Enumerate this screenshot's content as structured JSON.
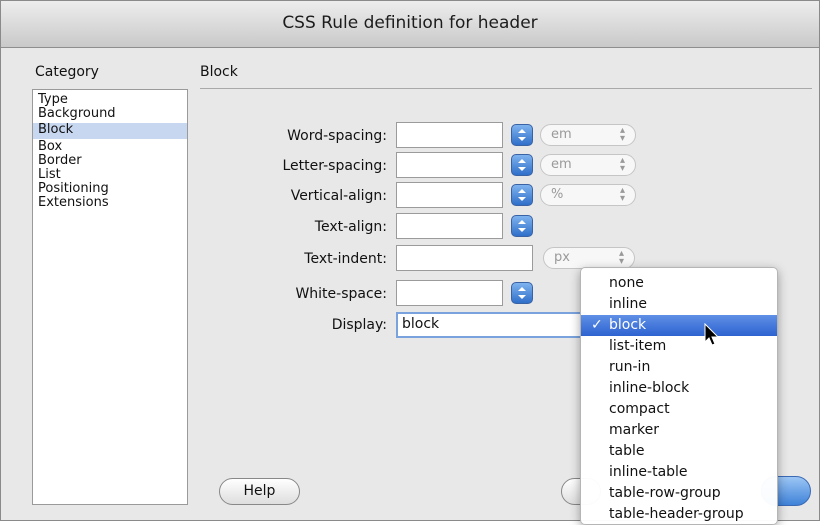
{
  "window": {
    "title": "CSS Rule definition for header"
  },
  "category": {
    "label": "Category",
    "items": [
      "Type",
      "Background",
      "Block",
      "Box",
      "Border",
      "List",
      "Positioning",
      "Extensions"
    ],
    "selected": "Block"
  },
  "section": {
    "title": "Block"
  },
  "rows": {
    "word_spacing": {
      "label": "Word-spacing:",
      "value": "",
      "unit": "em"
    },
    "letter_spacing": {
      "label": "Letter-spacing:",
      "value": "",
      "unit": "em"
    },
    "vertical_align": {
      "label": "Vertical-align:",
      "value": "",
      "unit": "%"
    },
    "text_align": {
      "label": "Text-align:",
      "value": ""
    },
    "text_indent": {
      "label": "Text-indent:",
      "value": "",
      "unit": "px"
    },
    "white_space": {
      "label": "White-space:",
      "value": ""
    },
    "display": {
      "label": "Display:",
      "value": "block"
    }
  },
  "display_menu": {
    "options": [
      "none",
      "inline",
      "block",
      "list-item",
      "run-in",
      "inline-block",
      "compact",
      "marker",
      "table",
      "inline-table",
      "table-row-group",
      "table-header-group"
    ],
    "selected": "block",
    "check": "✓"
  },
  "buttons": {
    "help": "Help"
  },
  "colors": {
    "selection": "#3a6fd6",
    "category_selected": "#c7d7ef"
  },
  "icons": {
    "stepper": "up-down-arrows-icon",
    "cursor": "mouse-pointer-icon"
  }
}
